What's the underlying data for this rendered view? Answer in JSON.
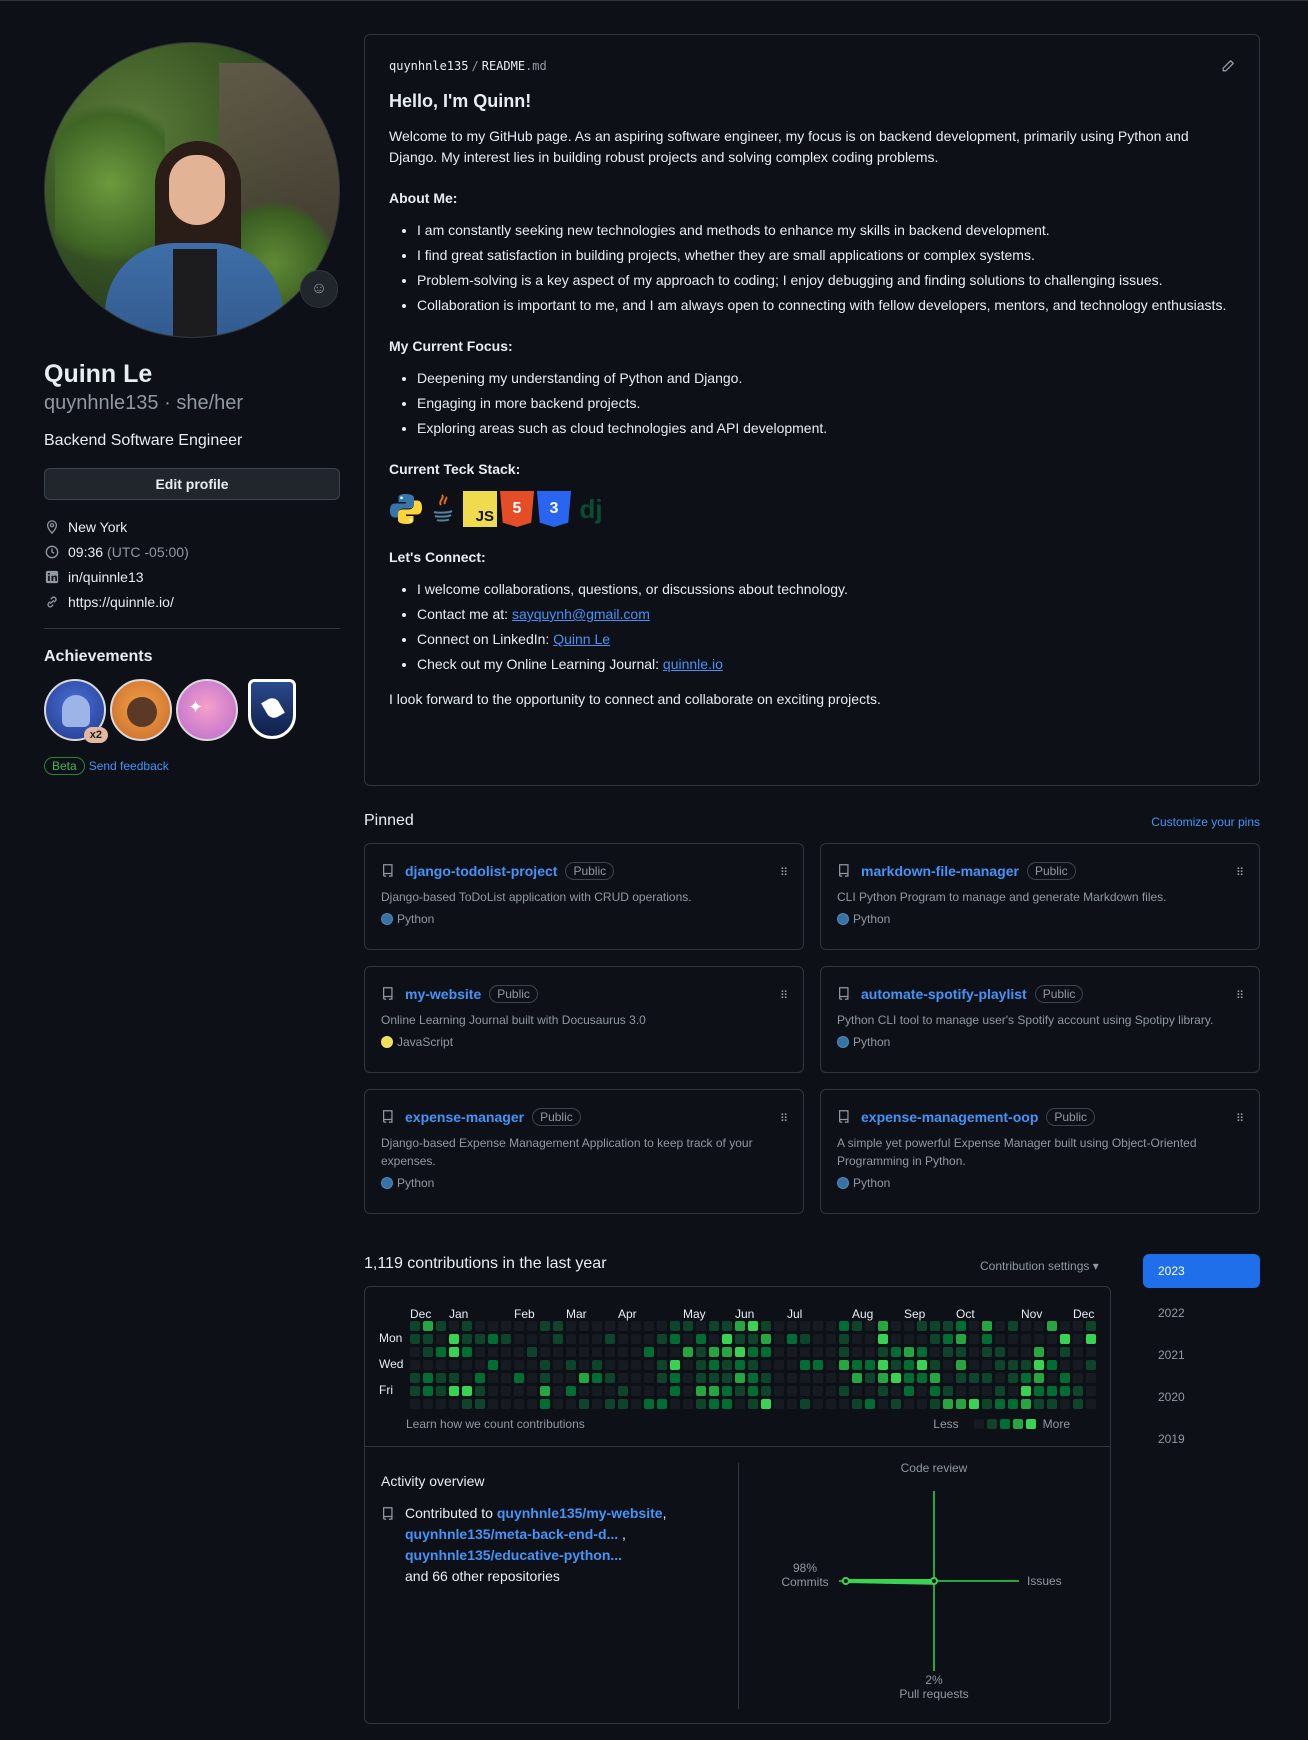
{
  "profile": {
    "name": "Quinn Le",
    "login": "quynhnle135",
    "pronouns": "· she/her",
    "bio": "Backend Software Engineer",
    "edit_label": "Edit profile",
    "location": "New York",
    "time": "09:36",
    "timezone": "(UTC -05:00)",
    "linkedin": "in/quinnle13",
    "website": "https://quinnle.io/",
    "emoji_icon": "smiley-icon"
  },
  "achievements": {
    "title": "Achievements",
    "badges": [
      {
        "name": "shark-badge",
        "count": "x2"
      },
      {
        "name": "cowboy-badge"
      },
      {
        "name": "yolo-badge"
      },
      {
        "name": "rocket-shield-badge"
      }
    ],
    "beta_label": "Beta",
    "feedback_label": "Send feedback"
  },
  "readme": {
    "path_user": "quynhnle135",
    "path_file": "README",
    "path_ext": ".md",
    "heading": "Hello, I'm Quinn!",
    "intro": "Welcome to my GitHub page. As an aspiring software engineer, my focus is on backend development, primarily using Python and Django. My interest lies in building robust projects and solving complex coding problems.",
    "about_title": "About Me:",
    "about_items": [
      "I am constantly seeking new technologies and methods to enhance my skills in backend development.",
      "I find great satisfaction in building projects, whether they are small applications or complex systems.",
      "Problem-solving is a key aspect of my approach to coding; I enjoy debugging and finding solutions to challenging issues.",
      "Collaboration is important to me, and I am always open to connecting with fellow developers, mentors, and technology enthusiasts."
    ],
    "focus_title": "My Current Focus:",
    "focus_items": [
      "Deepening my understanding of Python and Django.",
      "Engaging in more backend projects.",
      "Exploring areas such as cloud technologies and API development."
    ],
    "stack_title": "Current Teck Stack:",
    "stack": {
      "js": "JS",
      "html": "5",
      "css": "3",
      "dj": "dj"
    },
    "connect_title": "Let's Connect:",
    "connect_1": "I welcome collaborations, questions, or discussions about technology.",
    "connect_2_prefix": "Contact me at: ",
    "connect_2_link": "sayquynh@gmail.com",
    "connect_3_prefix": "Connect on LinkedIn: ",
    "connect_3_link": "Quinn Le",
    "connect_4_prefix": "Check out my Online Learning Journal: ",
    "connect_4_link": "quinnle.io",
    "closing": "I look forward to the opportunity to connect and collaborate on exciting projects."
  },
  "pinned": {
    "title": "Pinned",
    "customize": "Customize your pins",
    "public_label": "Public",
    "items": [
      {
        "name": "django-todolist-project",
        "desc": "Django-based ToDoList application with CRUD operations.",
        "lang": "Python",
        "color": "#3572A5"
      },
      {
        "name": "markdown-file-manager",
        "desc": "CLI Python Program to manage and generate Markdown files.",
        "lang": "Python",
        "color": "#3572A5"
      },
      {
        "name": "my-website",
        "desc": "Online Learning Journal built with Docusaurus 3.0",
        "lang": "JavaScript",
        "color": "#f1e05a"
      },
      {
        "name": "automate-spotify-playlist",
        "desc": "Python CLI tool to manage user's Spotify account using Spotipy library.",
        "lang": "Python",
        "color": "#3572A5"
      },
      {
        "name": "expense-manager",
        "desc": "Django-based Expense Management Application to keep track of your expenses.",
        "lang": "Python",
        "color": "#3572A5"
      },
      {
        "name": "expense-management-oop",
        "desc": "A simple yet powerful Expense Manager built using Object-Oriented Programming in Python.",
        "lang": "Python",
        "color": "#3572A5"
      }
    ]
  },
  "contributions": {
    "title": "1,119 contributions in the last year",
    "settings": "Contribution settings ▾",
    "months": [
      "Dec",
      "Jan",
      "Feb",
      "Mar",
      "Apr",
      "May",
      "Jun",
      "Jul",
      "Aug",
      "Sep",
      "Oct",
      "Nov",
      "Dec"
    ],
    "days": [
      "Mon",
      "Wed",
      "Fri"
    ],
    "learn": "Learn how we count contributions",
    "less": "Less",
    "more": "More",
    "colors": [
      "#161b22",
      "#0e4429",
      "#006d32",
      "#26a641",
      "#39d353"
    ]
  },
  "activity": {
    "title": "Activity overview",
    "prefix": "Contributed to ",
    "repo1": "quynhnle135/my-website",
    "repo2": "quynhnle135/meta-back-end-d...",
    "repo3": "quynhnle135/educative-python...",
    "suffix": "and 66 other repositories",
    "code_review": "Code review",
    "issues": "Issues",
    "commits_pct": "98%",
    "commits": "Commits",
    "pr_pct": "2%",
    "pull_requests": "Pull requests",
    "breakdown": {
      "commits": 98,
      "pull_requests": 2,
      "issues": 0,
      "code_review": 0
    }
  },
  "years": [
    "2023",
    "2022",
    "2021",
    "2020",
    "2019"
  ],
  "active_year": "2023"
}
